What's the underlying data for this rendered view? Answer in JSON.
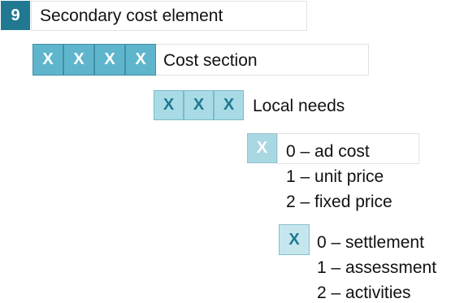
{
  "level1": {
    "badge": "9",
    "title": "Secondary cost element"
  },
  "level2": {
    "cells": [
      "X",
      "X",
      "X",
      "X"
    ],
    "label": "Cost section"
  },
  "level3": {
    "cells": [
      "X",
      "X",
      "X"
    ],
    "label": "Local needs"
  },
  "level4": {
    "cell": "X",
    "options": [
      "0 – ad cost",
      "1 – unit price",
      "2 – fixed price"
    ]
  },
  "level5": {
    "cell": "X",
    "options": [
      "0 – settlement",
      "1 – assessment",
      "2 – activities"
    ]
  },
  "colors": {
    "badge": "#217891",
    "cell_medium": "#5fb6cc",
    "cell_light": "#a8dbe6",
    "cell_text": "#1e7a90"
  }
}
